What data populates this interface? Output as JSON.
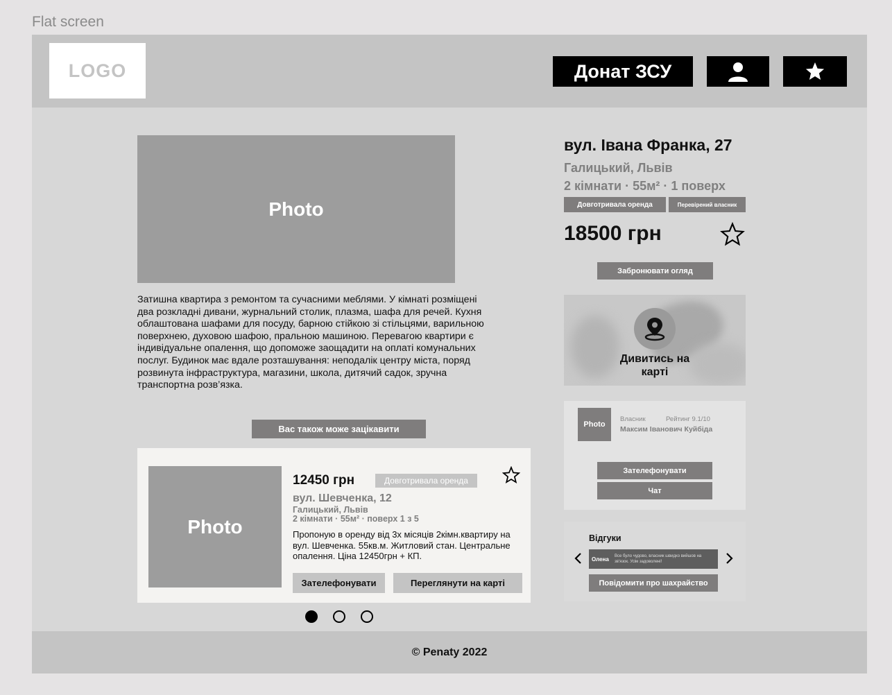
{
  "frame_label": "Flat screen",
  "header": {
    "logo": "LOGO",
    "donate_label": "Донат ЗСУ",
    "icons": {
      "user": "user-icon",
      "favorite": "star-icon"
    }
  },
  "listing": {
    "photo_label": "Photo",
    "address": "вул. Івана Франка, 27",
    "district": "Галицький, Львів",
    "meta": "2 кімнати · 55м²  · 1 поверх",
    "tags": [
      "Довготривала оренда",
      "Перевірений власник"
    ],
    "price": "18500 грн",
    "book_label": "Забронювати огляд",
    "description": "Затишна квартира з ремонтом та сучасними меблями. У кімнаті розміщені два розкладні дивани, журнальний столик, плазма, шафа для речей. Кухня облаштована шафами для посуду, барною стійкою зі стільцями, варильною поверхнею, духовою шафою, пральною машиною. Перевагою квартири є індивідуальне опалення, що допоможе заощадити на оплаті комунальних послуг. Будинок має вдале розташування: неподалік центру міста, поряд розвинута інфраструктура, магазини, школа, дитячий садок, зручна транспортна розв’язка."
  },
  "map": {
    "label": "Дивитись на карті"
  },
  "owner": {
    "photo_label": "Photo",
    "role": "Власник",
    "rating": "Рейтинг 9.1/10",
    "name": "Максим Іванович Куйбіда",
    "call_label": "Зателефонувати",
    "chat_label": "Чат"
  },
  "reviews": {
    "title": "Відгуки",
    "items": [
      {
        "name": "Олена",
        "text": "Все було чудово, власник швидко вийшов на зв'язок. Усім задоволені!"
      }
    ],
    "fraud_label": "Повідомити про шахрайство"
  },
  "also": {
    "label": "Вас також може зацікавити",
    "card": {
      "photo_label": "Photo",
      "price": "12450 грн",
      "tag": "Довготривала оренда",
      "street": "вул. Шевченка, 12",
      "district": "Галицький, Львів",
      "meta": "2 кімнати · 55м²  · поверх 1 з 5",
      "description": "Пропоную в оренду від 3х місяців 2кімн.квартиру на вул. Шевченка. 55кв.м. Житловий стан. Центральне опалення. Ціна 12450грн + КП.",
      "call_label": "Зателефонувати",
      "map_label": "Переглянути на карті"
    },
    "pagination": {
      "total": 3,
      "active": 1
    }
  },
  "footer": {
    "text": "© Penaty 2022"
  }
}
